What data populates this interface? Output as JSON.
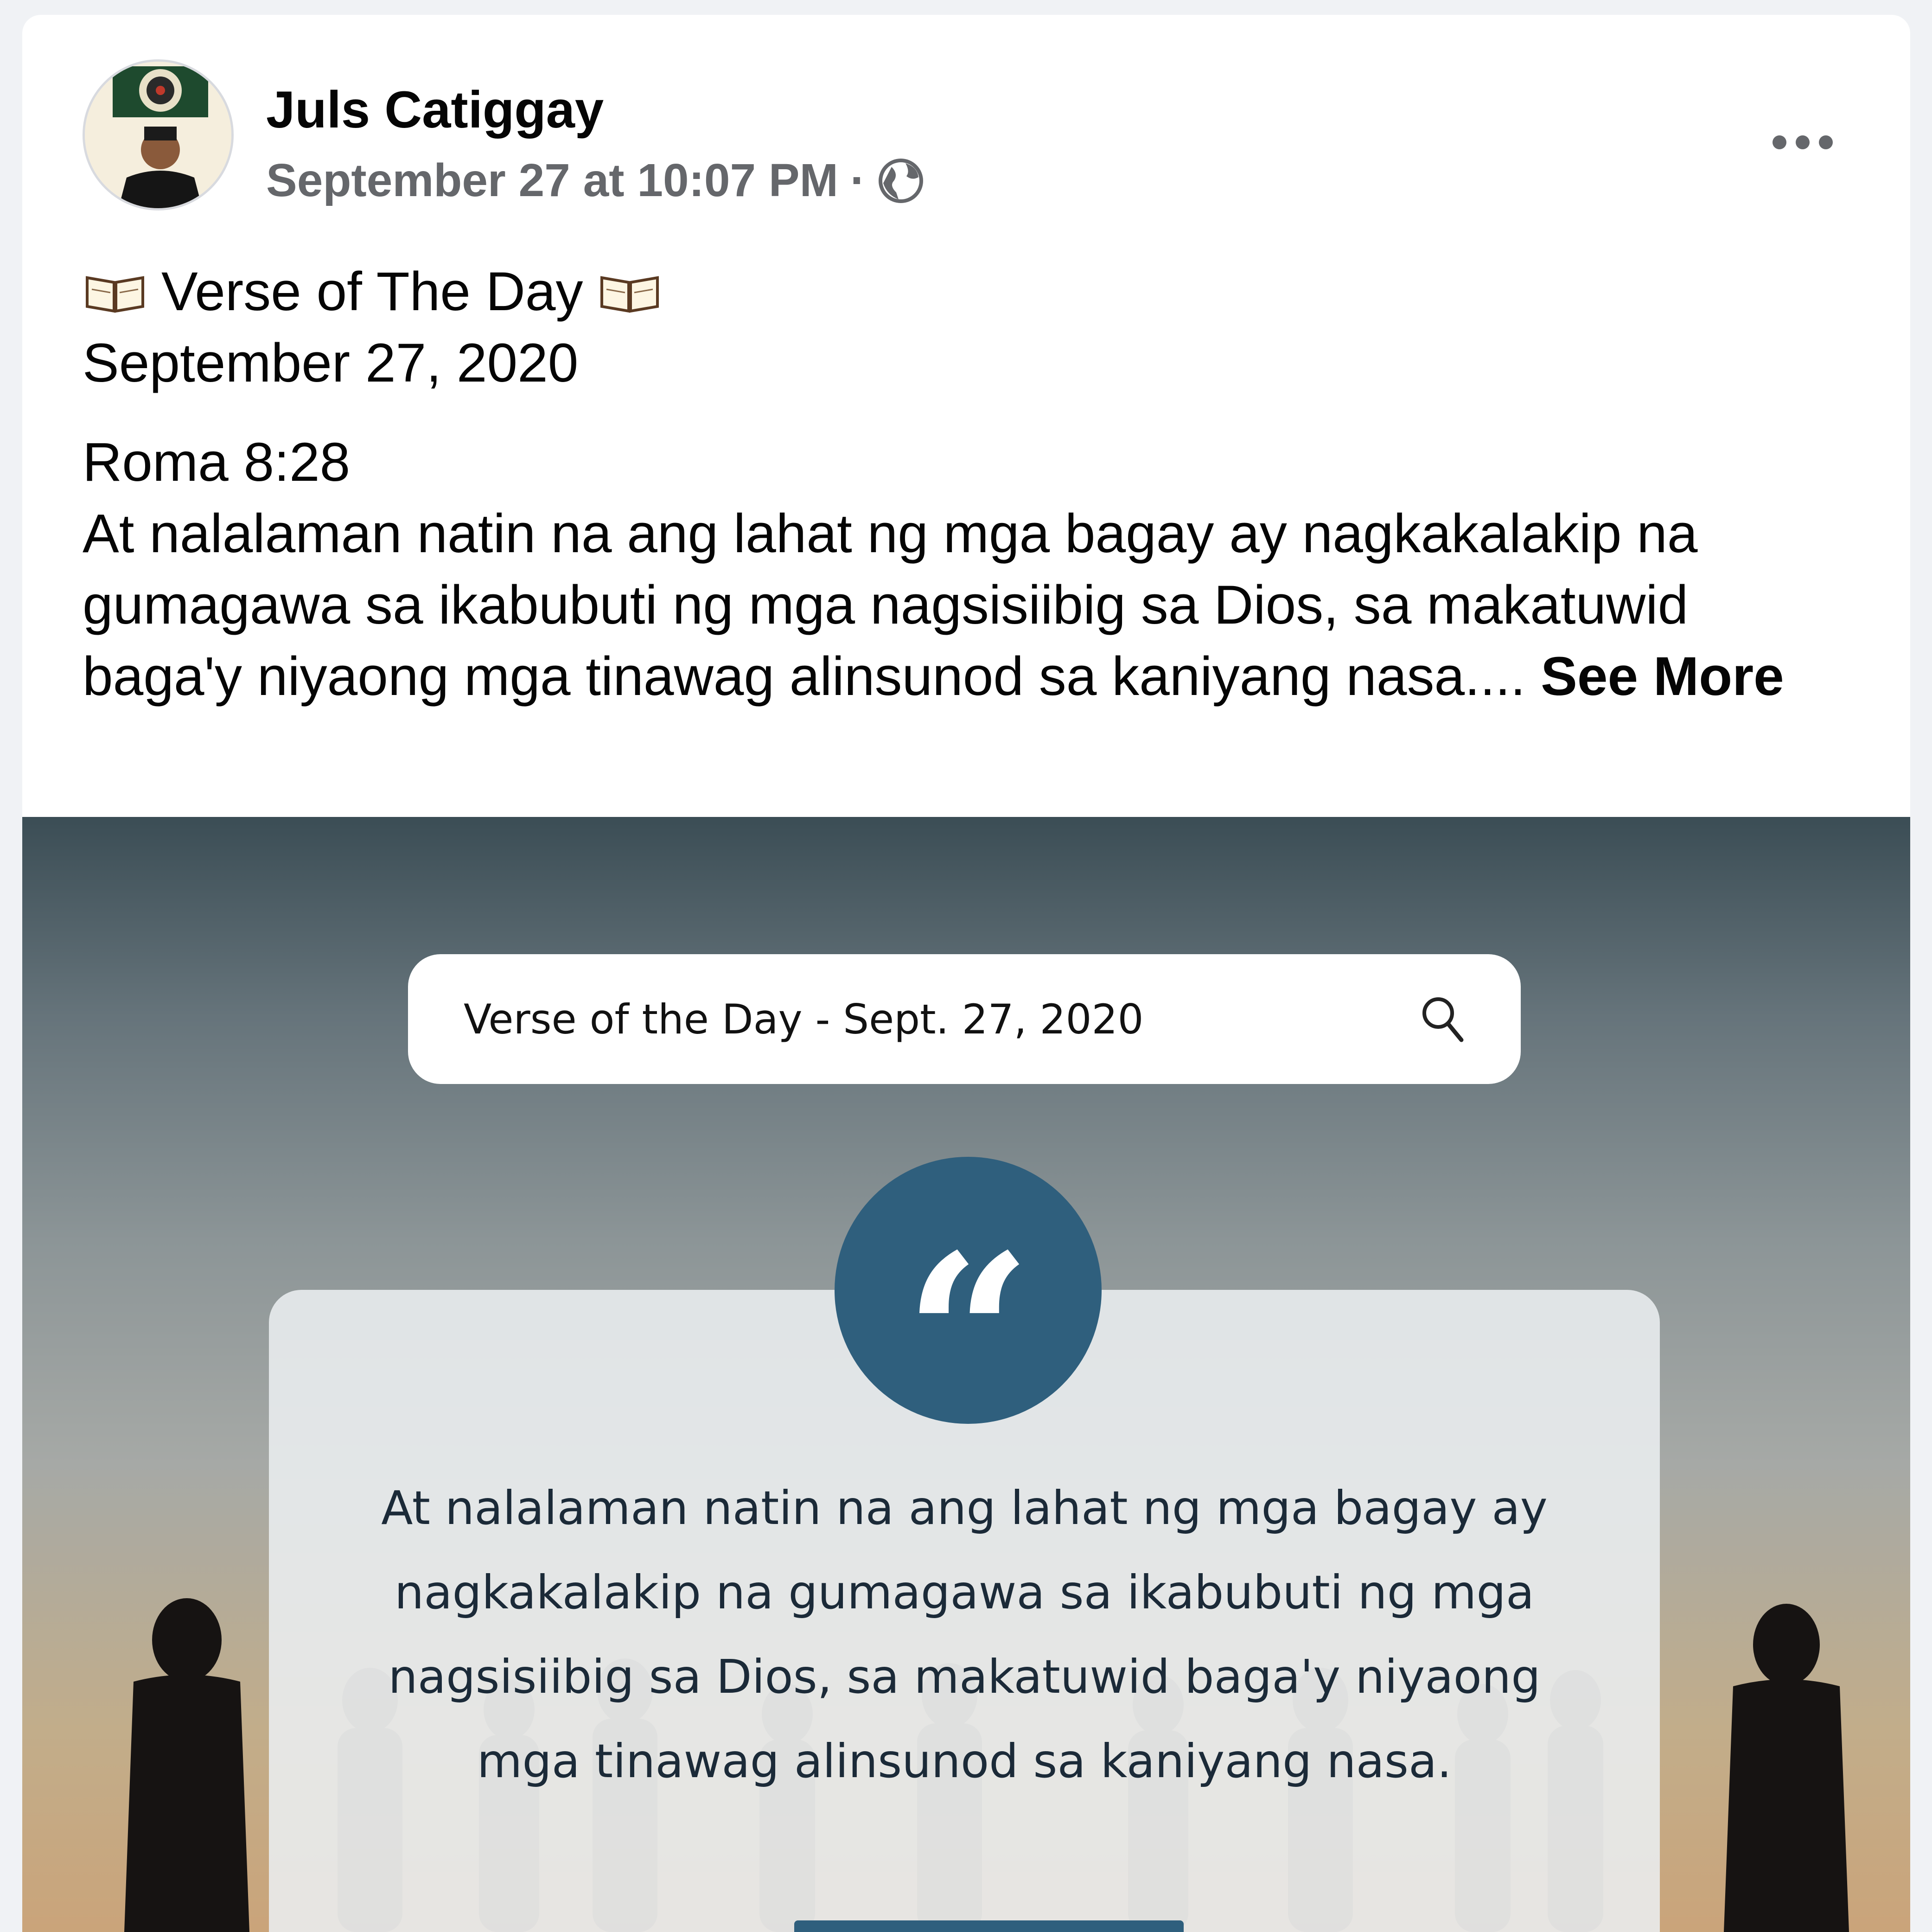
{
  "post": {
    "author": "Juls Catiggay",
    "timestamp": "September 27 at 10:07 PM",
    "separator": "·",
    "audience_icon": "globe-icon",
    "more_icon": "more-options-icon",
    "heading": "Verse of The Day",
    "heading_icon": "open-book-icon",
    "date": "September 27, 2020",
    "reference": "Roma 8:28",
    "body": "At nalalaman natin na ang lahat ng mga bagay ay nagkakalakip na gumagawa sa ikabubuti ng mga nagsisiibig sa Dios, sa makatuwid baga'y niyaong mga tinawag alinsunod sa kaniyang nasa....",
    "see_more_label": "See More"
  },
  "image": {
    "search_text": "Verse of the Day - Sept. 27, 2020",
    "search_icon": "search-icon",
    "quote_icon": "quote-icon",
    "quote_mark": "“",
    "quote_text": "At nalalaman natin na ang lahat ng mga bagay ay nagkakalakip na gumagawa sa ikabubuti ng mga nagsisiibig sa Dios, sa makatuwid baga'y niyaong mga tinawag alinsunod sa kaniyang nasa.",
    "accent_color": "#2f5f7d"
  }
}
